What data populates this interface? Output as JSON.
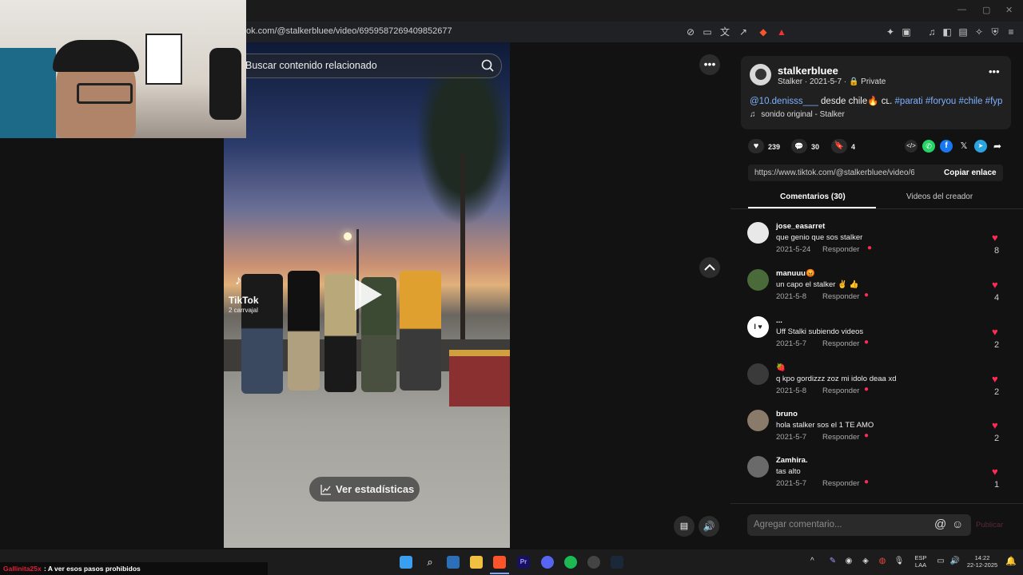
{
  "browser": {
    "url": "ok.com/@stalkerbluee/video/6959587269409852677"
  },
  "video": {
    "search_placeholder": "Buscar contenido relacionado",
    "watermark_brand": "TikTok",
    "watermark_user": "2 carrvajal",
    "stats_label": "Ver estadísticas"
  },
  "post": {
    "username": "stalkerbluee",
    "meta": "Stalker · 2021-5-7 ·",
    "privacy": "Private",
    "description_mention": "@10.denisss___",
    "description_text": " desde chile🔥 ᴄʟ. ",
    "description_tags": "#parati #foryou #chile #fyp",
    "sound": "sonido original - Stalker",
    "likes": "239",
    "comments": "30",
    "saves": "4",
    "link": "https://www.tiktok.com/@stalkerbluee/video/6959...",
    "copy_label": "Copiar enlace"
  },
  "tabs": {
    "comments": "Comentarios (30)",
    "creator_videos": "Videos del creador"
  },
  "comments": [
    {
      "user": "jose_easarret",
      "text": "que genio que sos stalker",
      "date": "2021-5-24",
      "reply": "Responder",
      "likes": "8"
    },
    {
      "user": "manuuu😡",
      "text": "un capo el stalker ✌ 👍",
      "date": "2021-5-8",
      "reply": "Responder",
      "likes": "4"
    },
    {
      "user": "...",
      "text": "Uff Stalki subiendo videos",
      "date": "2021-5-7",
      "reply": "Responder",
      "likes": "2"
    },
    {
      "user": "🍓",
      "text": "q kpo gordizzz zoz mi idolo deaa xd",
      "date": "2021-5-8",
      "reply": "Responder",
      "likes": "2"
    },
    {
      "user": "bruno",
      "text": "hola stalker sos el 1 TE AMO",
      "date": "2021-5-7",
      "reply": "Responder",
      "likes": "2"
    },
    {
      "user": "Zamhira.",
      "text": "tas alto",
      "date": "2021-5-7",
      "reply": "Responder",
      "likes": "1"
    }
  ],
  "composer": {
    "placeholder": "Agregar comentario...",
    "publish_label": "Publicar"
  },
  "chat": {
    "user": "Gallinita25x",
    "message": ": A ver esos pasos prohibidos"
  },
  "system_tray": {
    "lang_1": "ESP",
    "lang_2": "LAA",
    "time": "14:22",
    "date": "22-12-2025"
  },
  "colors": {
    "accent": "#fe2c55",
    "hashtag": "#7fb0ff"
  }
}
